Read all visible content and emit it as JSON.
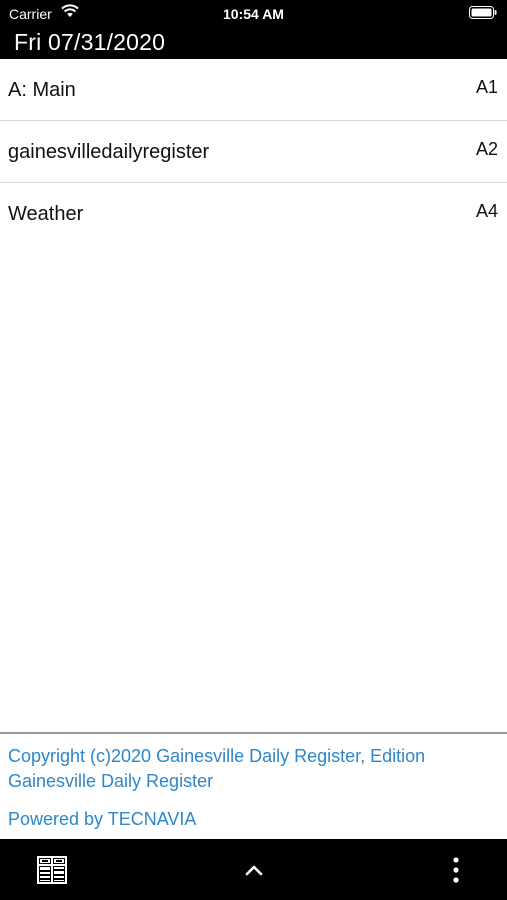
{
  "status_bar": {
    "carrier": "Carrier",
    "time": "10:54 AM"
  },
  "header": {
    "date": "Fri 07/31/2020"
  },
  "sections": [
    {
      "name": "A: Main",
      "page": "A1"
    },
    {
      "name": "gainesvilledailyregister",
      "page": "A2"
    },
    {
      "name": "Weather",
      "page": "A4"
    }
  ],
  "footer": {
    "copyright": "Copyright (c)2020 Gainesville Daily Register, Edition Gainesville Daily Register",
    "powered_by": "Powered by TECNAVIA"
  },
  "toolbar": {
    "icons": [
      "pages-grid-icon",
      "chevron-up-icon",
      "more-vertical-icon"
    ]
  },
  "colors": {
    "bar_background": "#000000",
    "link": "#2f86c8",
    "divider": "#dadada"
  }
}
